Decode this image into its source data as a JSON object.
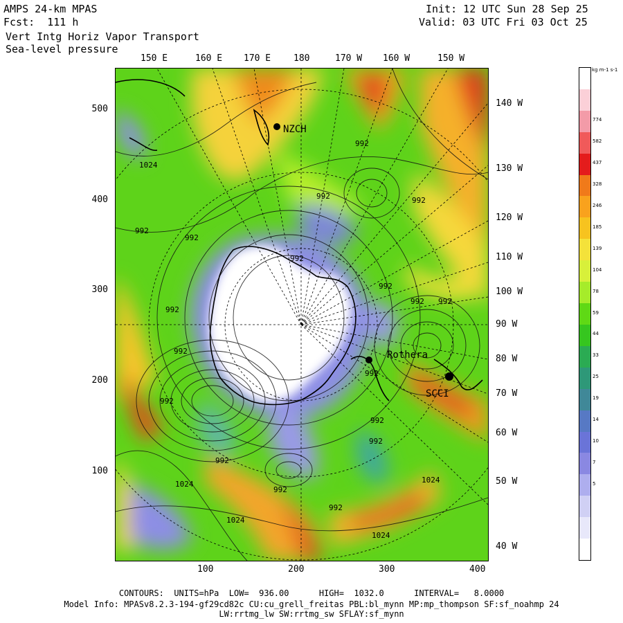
{
  "header": {
    "model": "AMPS 24-km MPAS",
    "forecast": "Fcst:  111 h",
    "field1": "Vert Intg Horiz Vapor Transport",
    "field2": "Sea-level pressure",
    "init": "Init: 12 UTC Sun 28 Sep 25",
    "valid": "Valid: 03 UTC Fri 03 Oct 25"
  },
  "lon_top": [
    "150 E",
    "160 E",
    "170 E",
    "180",
    "170 W",
    "160 W",
    "150 W"
  ],
  "lon_right": [
    "140 W",
    "130 W",
    "120 W",
    "110 W",
    "100 W",
    "90 W",
    "80 W",
    "70 W",
    "60 W",
    "50 W",
    "40 W"
  ],
  "y_axis": [
    "500",
    "400",
    "300",
    "200",
    "100"
  ],
  "x_axis": [
    "100",
    "200",
    "300",
    "400"
  ],
  "stations": [
    "NZCH",
    "Rothera",
    "SCCI"
  ],
  "contour_labels": [
    "1024",
    "992",
    "992",
    "992",
    "992",
    "992",
    "992",
    "992",
    "992",
    "992",
    "992",
    "992",
    "992",
    "992",
    "992",
    "992",
    "992",
    "992",
    "992",
    "1024",
    "1024",
    "1024",
    "1024"
  ],
  "colorbar": {
    "units": "kg m-1 s-1",
    "labels": [
      "774",
      "582",
      "437",
      "328",
      "246",
      "185",
      "139",
      "104",
      "78",
      "59",
      "44",
      "33",
      "25",
      "19",
      "14",
      "10",
      "7",
      "5"
    ],
    "colors": [
      "#ffffff",
      "#fbd0d8",
      "#f39ba8",
      "#f05a5a",
      "#e41c1c",
      "#f07a1a",
      "#f9a21d",
      "#f7c31f",
      "#f4e23a",
      "#d8f03a",
      "#a6ec2a",
      "#5fd915",
      "#36c61f",
      "#2bab53",
      "#2e9878",
      "#408898",
      "#5779c4",
      "#6a74d8",
      "#8a88e2",
      "#aeaeee",
      "#d0d0f4",
      "#e8e8fa",
      "#ffffff"
    ]
  },
  "footer": {
    "line1": "CONTOURS:  UNITS=hPa  LOW=  936.00      HIGH=  1032.0      INTERVAL=   8.0000",
    "line2": "Model Info: MPASv8.2.3-194-gf29cd82c CU:cu_grell_freitas PBL:bl_mynn MP:mp_thompson SF:sf_noahmp 24",
    "line3": "LW:rrtmg_lw SW:rrtmg_sw SFLAY:sf_mynn"
  }
}
